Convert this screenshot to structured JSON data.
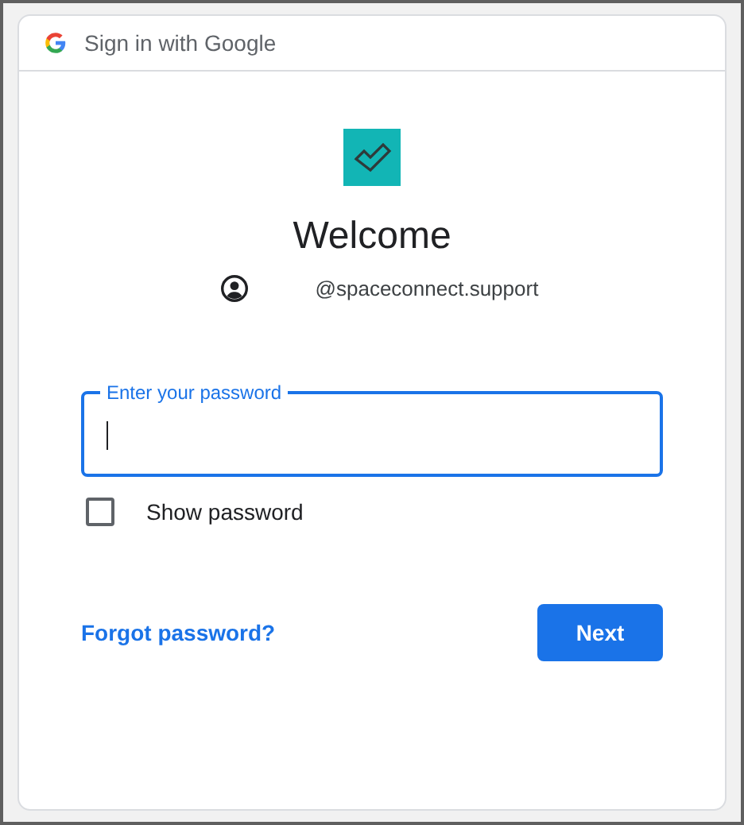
{
  "header": {
    "title": "Sign in with Google"
  },
  "heading": "Welcome",
  "account": {
    "email": "@spaceconnect.support"
  },
  "password_field": {
    "label": "Enter your password",
    "focused": true
  },
  "show_password": {
    "label": "Show password",
    "checked": false
  },
  "forgot_link": "Forgot password?",
  "next_button": "Next"
}
